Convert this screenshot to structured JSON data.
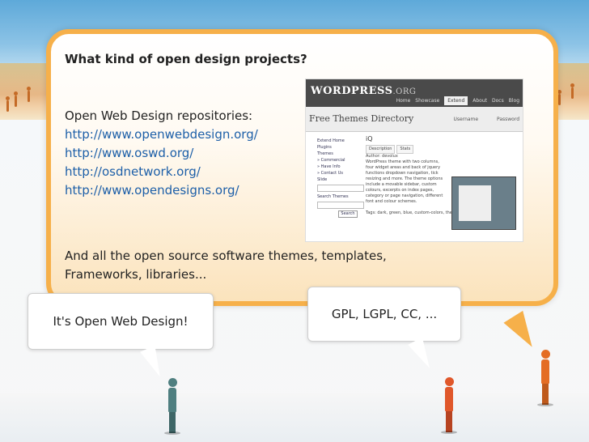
{
  "slide": {
    "heading": "What kind of open design projects?",
    "repos_title": "Open Web Design repositories:",
    "links": [
      "http://www.openwebdesign.org/",
      "http://www.oswd.org/",
      "http://osdnetwork.org/",
      "http://www.opendesigns.org/"
    ],
    "closing_line1": "And all the open source software themes, templates,",
    "closing_line2": "Frameworks, libraries..."
  },
  "callouts": {
    "left": "It's Open Web Design!",
    "right": "GPL, LGPL, CC, ..."
  },
  "colors": {
    "bubble_border": "#f6b04a",
    "link": "#1d5fa8",
    "person_left": "#4f7f80",
    "person_mid": "#e0572a",
    "person_right": "#e46d24"
  }
}
